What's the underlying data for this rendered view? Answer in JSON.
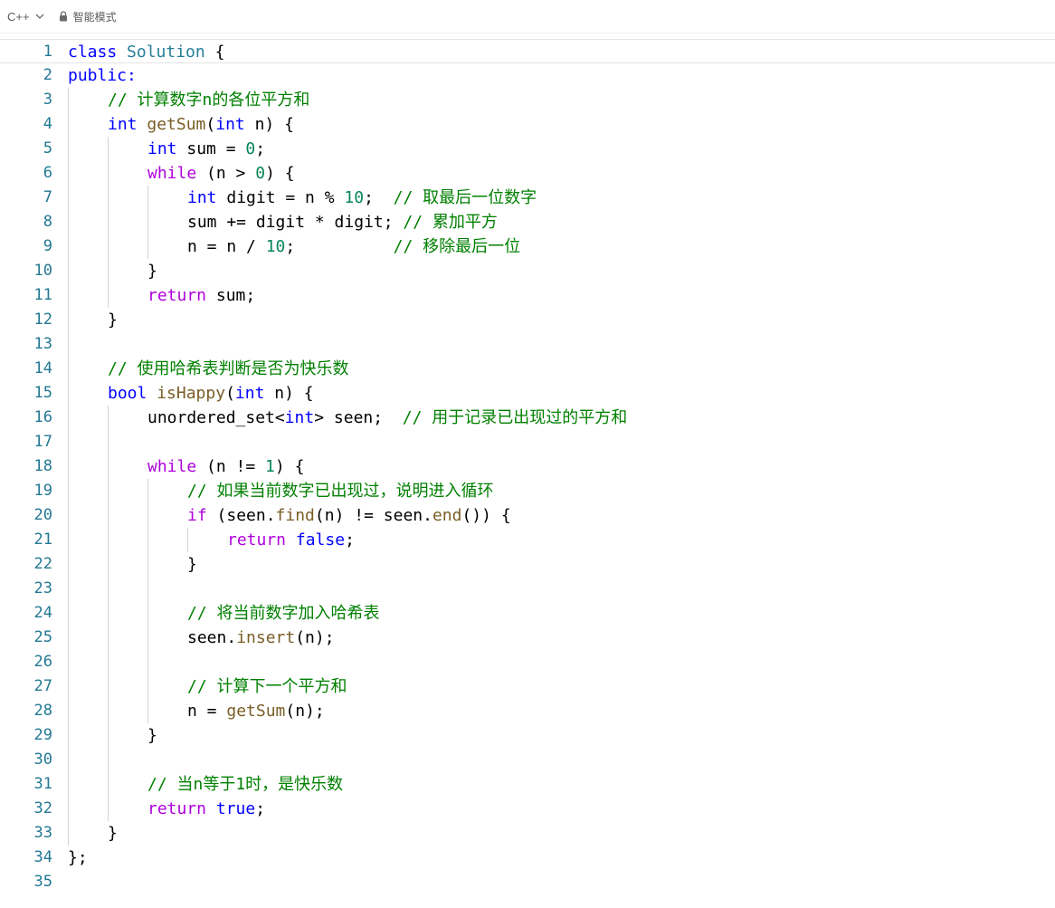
{
  "toolbar": {
    "language": "C++",
    "mode": "智能模式",
    "icons": {
      "language_dropdown": "chevron-down-icon",
      "mode": "lock-icon"
    }
  },
  "colors": {
    "keyword": "#0000ff",
    "control": "#af00db",
    "type": "#267f99",
    "function": "#795e26",
    "number": "#098658",
    "comment": "#008000",
    "line_number": "#237893"
  },
  "editor": {
    "current_line": 1,
    "lines": [
      {
        "n": "1",
        "indent": 0,
        "tokens": [
          {
            "t": "class",
            "c": "k-blue"
          },
          {
            "t": " ",
            "c": "t-plain"
          },
          {
            "t": "Solution",
            "c": "t-type"
          },
          {
            "t": " {",
            "c": "t-plain"
          }
        ]
      },
      {
        "n": "2",
        "indent": 0,
        "tokens": [
          {
            "t": "public:",
            "c": "k-blue"
          }
        ]
      },
      {
        "n": "3",
        "indent": 1,
        "tokens": [
          {
            "t": "// 计算数字n的各位平方和",
            "c": "t-com"
          }
        ]
      },
      {
        "n": "4",
        "indent": 1,
        "tokens": [
          {
            "t": "int",
            "c": "k-blue"
          },
          {
            "t": " ",
            "c": "t-plain"
          },
          {
            "t": "getSum",
            "c": "t-fn"
          },
          {
            "t": "(",
            "c": "t-plain"
          },
          {
            "t": "int",
            "c": "k-blue"
          },
          {
            "t": " n) {",
            "c": "t-plain"
          }
        ]
      },
      {
        "n": "5",
        "indent": 2,
        "tokens": [
          {
            "t": "int",
            "c": "k-blue"
          },
          {
            "t": " sum = ",
            "c": "t-plain"
          },
          {
            "t": "0",
            "c": "t-num"
          },
          {
            "t": ";",
            "c": "t-plain"
          }
        ]
      },
      {
        "n": "6",
        "indent": 2,
        "tokens": [
          {
            "t": "while",
            "c": "k-purple"
          },
          {
            "t": " (n > ",
            "c": "t-plain"
          },
          {
            "t": "0",
            "c": "t-num"
          },
          {
            "t": ") {",
            "c": "t-plain"
          }
        ]
      },
      {
        "n": "7",
        "indent": 3,
        "tokens": [
          {
            "t": "int",
            "c": "k-blue"
          },
          {
            "t": " digit = n % ",
            "c": "t-plain"
          },
          {
            "t": "10",
            "c": "t-num"
          },
          {
            "t": ";  ",
            "c": "t-plain"
          },
          {
            "t": "// 取最后一位数字",
            "c": "t-com"
          }
        ]
      },
      {
        "n": "8",
        "indent": 3,
        "tokens": [
          {
            "t": "sum += digit * digit; ",
            "c": "t-plain"
          },
          {
            "t": "// 累加平方",
            "c": "t-com"
          }
        ]
      },
      {
        "n": "9",
        "indent": 3,
        "tokens": [
          {
            "t": "n = n / ",
            "c": "t-plain"
          },
          {
            "t": "10",
            "c": "t-num"
          },
          {
            "t": ";          ",
            "c": "t-plain"
          },
          {
            "t": "// 移除最后一位",
            "c": "t-com"
          }
        ]
      },
      {
        "n": "10",
        "indent": 2,
        "tokens": [
          {
            "t": "}",
            "c": "t-plain"
          }
        ]
      },
      {
        "n": "11",
        "indent": 2,
        "tokens": [
          {
            "t": "return",
            "c": "k-purple"
          },
          {
            "t": " sum;",
            "c": "t-plain"
          }
        ]
      },
      {
        "n": "12",
        "indent": 1,
        "tokens": [
          {
            "t": "}",
            "c": "t-plain"
          }
        ]
      },
      {
        "n": "13",
        "indent": 0,
        "tokens": []
      },
      {
        "n": "14",
        "indent": 1,
        "tokens": [
          {
            "t": "// 使用哈希表判断是否为快乐数",
            "c": "t-com"
          }
        ]
      },
      {
        "n": "15",
        "indent": 1,
        "tokens": [
          {
            "t": "bool",
            "c": "k-blue"
          },
          {
            "t": " ",
            "c": "t-plain"
          },
          {
            "t": "isHappy",
            "c": "t-fn"
          },
          {
            "t": "(",
            "c": "t-plain"
          },
          {
            "t": "int",
            "c": "k-blue"
          },
          {
            "t": " n) {",
            "c": "t-plain"
          }
        ]
      },
      {
        "n": "16",
        "indent": 2,
        "tokens": [
          {
            "t": "unordered_set<",
            "c": "t-plain"
          },
          {
            "t": "int",
            "c": "k-blue"
          },
          {
            "t": "> seen;  ",
            "c": "t-plain"
          },
          {
            "t": "// 用于记录已出现过的平方和",
            "c": "t-com"
          }
        ]
      },
      {
        "n": "17",
        "indent": 0,
        "tokens": []
      },
      {
        "n": "18",
        "indent": 2,
        "tokens": [
          {
            "t": "while",
            "c": "k-purple"
          },
          {
            "t": " (n != ",
            "c": "t-plain"
          },
          {
            "t": "1",
            "c": "t-num"
          },
          {
            "t": ") {",
            "c": "t-plain"
          }
        ]
      },
      {
        "n": "19",
        "indent": 3,
        "tokens": [
          {
            "t": "// 如果当前数字已出现过，说明进入循环",
            "c": "t-com"
          }
        ]
      },
      {
        "n": "20",
        "indent": 3,
        "tokens": [
          {
            "t": "if",
            "c": "k-purple"
          },
          {
            "t": " (seen.",
            "c": "t-plain"
          },
          {
            "t": "find",
            "c": "t-fn"
          },
          {
            "t": "(n) != seen.",
            "c": "t-plain"
          },
          {
            "t": "end",
            "c": "t-fn"
          },
          {
            "t": "()) {",
            "c": "t-plain"
          }
        ]
      },
      {
        "n": "21",
        "indent": 4,
        "tokens": [
          {
            "t": "return",
            "c": "k-purple"
          },
          {
            "t": " ",
            "c": "t-plain"
          },
          {
            "t": "false",
            "c": "k-blue"
          },
          {
            "t": ";",
            "c": "t-plain"
          }
        ]
      },
      {
        "n": "22",
        "indent": 3,
        "tokens": [
          {
            "t": "}",
            "c": "t-plain"
          }
        ]
      },
      {
        "n": "23",
        "indent": 0,
        "tokens": []
      },
      {
        "n": "24",
        "indent": 3,
        "tokens": [
          {
            "t": "// 将当前数字加入哈希表",
            "c": "t-com"
          }
        ]
      },
      {
        "n": "25",
        "indent": 3,
        "tokens": [
          {
            "t": "seen.",
            "c": "t-plain"
          },
          {
            "t": "insert",
            "c": "t-fn"
          },
          {
            "t": "(n);",
            "c": "t-plain"
          }
        ]
      },
      {
        "n": "26",
        "indent": 0,
        "tokens": []
      },
      {
        "n": "27",
        "indent": 3,
        "tokens": [
          {
            "t": "// 计算下一个平方和",
            "c": "t-com"
          }
        ]
      },
      {
        "n": "28",
        "indent": 3,
        "tokens": [
          {
            "t": "n = ",
            "c": "t-plain"
          },
          {
            "t": "getSum",
            "c": "t-fn"
          },
          {
            "t": "(n);",
            "c": "t-plain"
          }
        ]
      },
      {
        "n": "29",
        "indent": 2,
        "tokens": [
          {
            "t": "}",
            "c": "t-plain"
          }
        ]
      },
      {
        "n": "30",
        "indent": 0,
        "tokens": []
      },
      {
        "n": "31",
        "indent": 2,
        "tokens": [
          {
            "t": "// 当n等于1时，是快乐数",
            "c": "t-com"
          }
        ]
      },
      {
        "n": "32",
        "indent": 2,
        "tokens": [
          {
            "t": "return",
            "c": "k-purple"
          },
          {
            "t": " ",
            "c": "t-plain"
          },
          {
            "t": "true",
            "c": "k-blue"
          },
          {
            "t": ";",
            "c": "t-plain"
          }
        ]
      },
      {
        "n": "33",
        "indent": 1,
        "tokens": [
          {
            "t": "}",
            "c": "t-plain"
          }
        ]
      },
      {
        "n": "34",
        "indent": 0,
        "tokens": [
          {
            "t": "};",
            "c": "t-plain"
          }
        ]
      },
      {
        "n": "35",
        "indent": 0,
        "tokens": []
      }
    ]
  }
}
